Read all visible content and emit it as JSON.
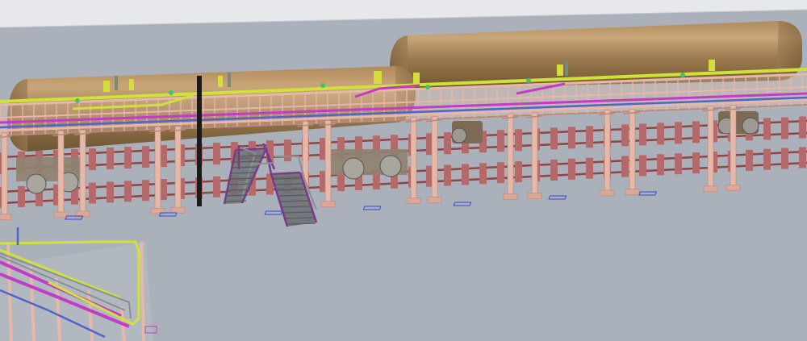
{
  "scene": {
    "kind": "3d-plant-model-viewport",
    "colors": {
      "background": "#aab1ba",
      "background_top_band": "#e3e6ea",
      "tank": "#9c7a4e",
      "tank_highlight": "#c9a67a",
      "tank_shadow": "#6e5534",
      "structure": "#e5b8a8",
      "structure_dark": "#b9887a",
      "rail_sleeper": "#b46a6a",
      "rail": "#8d4646",
      "pipe_yellow": "#cfe23a",
      "pipe_magenta": "#c23cc6",
      "pipe_blue": "#4e66c8",
      "stair_purple": "#7a3a86",
      "stair_grey": "#8a8f96",
      "vertical_pipe": "#1a1a1a",
      "footprint_blue": "#3448d6"
    }
  }
}
